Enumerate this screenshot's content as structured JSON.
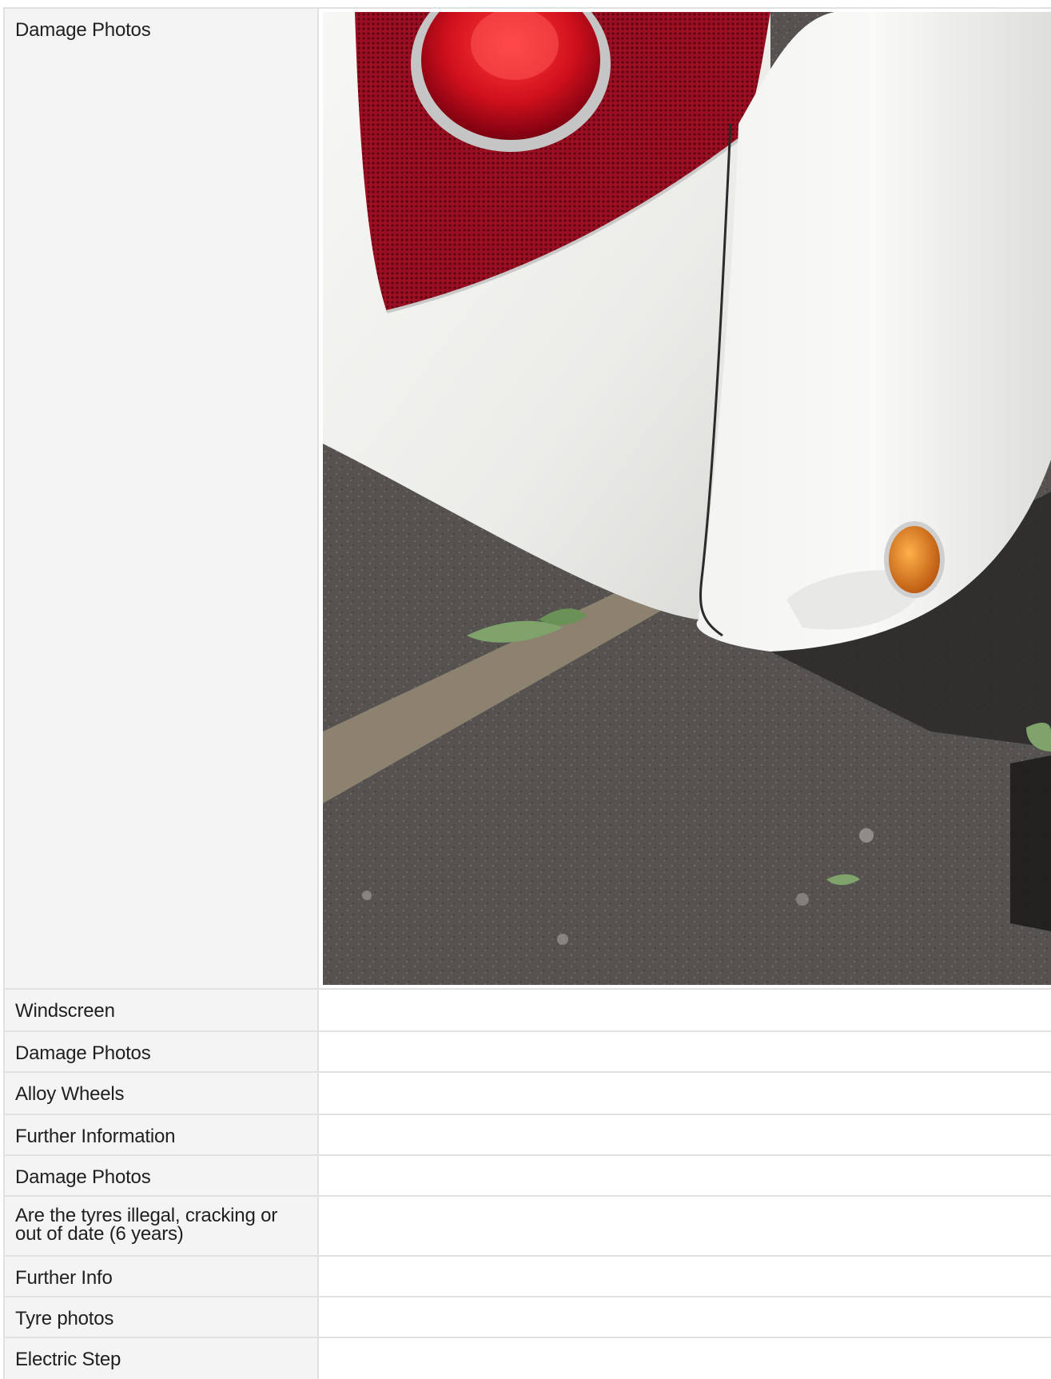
{
  "report": {
    "rows": [
      {
        "label": "Damage Photos",
        "has_photo": true
      },
      {
        "label": "Windscreen",
        "value": ""
      },
      {
        "label": "Damage Photos",
        "value": ""
      },
      {
        "label": "Alloy Wheels",
        "value": ""
      },
      {
        "label": "Further Information",
        "value": ""
      },
      {
        "label": "Damage Photos",
        "value": ""
      },
      {
        "label": "Are the tyres illegal, cracking or out of date (6 years)",
        "value": ""
      },
      {
        "label": "Further Info",
        "value": ""
      },
      {
        "label": "Tyre photos",
        "value": ""
      },
      {
        "label": "Electric Step",
        "value": ""
      }
    ]
  },
  "colors": {
    "label_bg": "#f4f4f4",
    "border": "#e1e1e1",
    "body_paint": "#efefec",
    "tail_light": "#b5122a",
    "indicator": "#e07a12",
    "tarmac": "#55524f"
  }
}
